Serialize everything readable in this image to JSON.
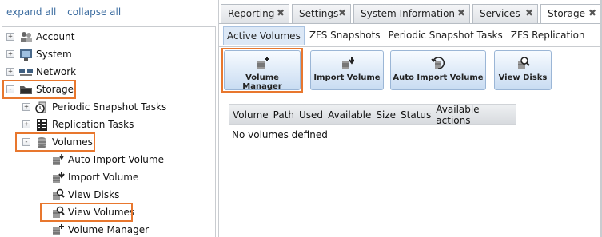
{
  "tree_controls": {
    "expand": "expand all",
    "collapse": "collapse all"
  },
  "tree": [
    {
      "label": "Account",
      "icon": "account-icon",
      "toggle": "+"
    },
    {
      "label": "System",
      "icon": "system-icon",
      "toggle": "+"
    },
    {
      "label": "Network",
      "icon": "network-icon",
      "toggle": "+"
    },
    {
      "label": "Storage",
      "icon": "storage-icon",
      "toggle": "-"
    },
    {
      "label": "Periodic Snapshot Tasks",
      "icon": "snapshot-icon",
      "toggle": "+"
    },
    {
      "label": "Replication Tasks",
      "icon": "replication-icon",
      "toggle": "+"
    },
    {
      "label": "Volumes",
      "icon": "volumes-icon",
      "toggle": "-"
    },
    {
      "label": "Auto Import Volume",
      "icon": "auto-import-icon"
    },
    {
      "label": "Import Volume",
      "icon": "import-volume-icon"
    },
    {
      "label": "View Disks",
      "icon": "view-disks-icon"
    },
    {
      "label": "View Volumes",
      "icon": "view-volumes-icon"
    },
    {
      "label": "Volume Manager",
      "icon": "volume-manager-icon"
    }
  ],
  "tabs": [
    {
      "label": "Reporting",
      "close": "✖"
    },
    {
      "label": "Settings",
      "close": "✖"
    },
    {
      "label": "System Information",
      "close": "✖"
    },
    {
      "label": "Services",
      "close": "✖"
    },
    {
      "label": "Storage",
      "close": "✖",
      "active": true
    }
  ],
  "subtabs": [
    "Active Volumes",
    "ZFS Snapshots",
    "Periodic Snapshot Tasks",
    "ZFS Replication"
  ],
  "actions": [
    "Volume Manager",
    "Import Volume",
    "Auto Import Volume",
    "View Disks"
  ],
  "grid": {
    "columns": [
      "Volume",
      "Path",
      "Used",
      "Available",
      "Size",
      "Status",
      "Available actions"
    ],
    "empty": "No volumes defined"
  },
  "colors": {
    "highlight": "#e8772e",
    "link": "#3d6da0",
    "button_gradient_bottom": "#c9dcf2"
  }
}
